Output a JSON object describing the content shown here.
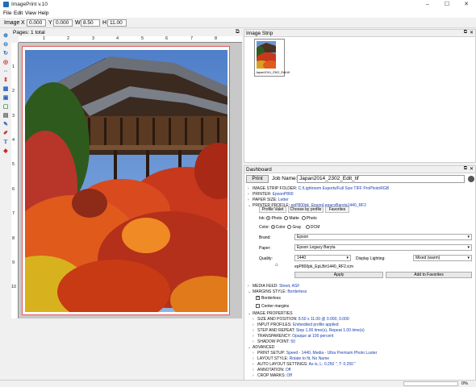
{
  "window": {
    "title": "ImagePrint v.10",
    "min": "–",
    "max": "☐",
    "close": "✕"
  },
  "menu": [
    "File",
    "Edit",
    "View",
    "Help"
  ],
  "toolbar": {
    "image_label": "Image",
    "x_label": "X",
    "x_value": "0.000",
    "y_label": "Y",
    "y_value": "0.000",
    "w_label": "W",
    "w_value": "8.50",
    "h_label": "H",
    "h_value": "11.00"
  },
  "pages": {
    "header": "Pages: 1 total"
  },
  "ruler": {
    "horizontal": [
      "1",
      "2",
      "3",
      "4",
      "5",
      "6",
      "7",
      "8"
    ],
    "vertical": [
      "1",
      "2",
      "3",
      "4",
      "5",
      "6",
      "7",
      "8",
      "9",
      "10"
    ]
  },
  "strip": {
    "header": "Image Strip",
    "thumb_label": "Japan2014_2302_Edit.tif"
  },
  "dashboard": {
    "header": "Dashboard",
    "print_label": "Print",
    "job_name_label": "Job Name:",
    "job_name_value": "Japan2014_2302_Edit_tif",
    "sections_top": [
      {
        "key": "IMAGE STRIP FOLDER:",
        "value": "C:/Lightroom Exports/Full Size TIFF ProPhotoRGB"
      },
      {
        "key": "PRINTER:",
        "value": "EpsonP800"
      },
      {
        "key": "PAPER SIZE:",
        "value": "Letter"
      },
      {
        "key": "PRINTER PROFILE:",
        "value": "epP800pk_EpsonLegacyBaryta1440_RF2"
      }
    ],
    "profile_tabs": [
      "Profile Valet",
      "Choose by profile",
      "Favorites"
    ],
    "ink": {
      "label": "Ink:",
      "options": [
        "Photo",
        "Matte",
        "Photo"
      ]
    },
    "color": {
      "label": "Color:",
      "options": [
        "Color",
        "Gray",
        "DCM"
      ]
    },
    "brand": {
      "label": "Brand:",
      "value": "Epson"
    },
    "paper": {
      "label": "Paper:",
      "value": "Epson Legacy Baryta"
    },
    "quality": {
      "label": "Quality:",
      "value": "1440"
    },
    "lighting": {
      "label": "Display Lighting:",
      "value": "Mixed (warm)"
    },
    "icc_file": "epP800pk_EpLBrt1440_RF2.icm",
    "apply_label": "Apply",
    "fav_label": "Add to Favorites",
    "media": [
      {
        "key": "MEDIA FEED:",
        "value": "Sheet, ASF"
      },
      {
        "key": "MARGINS STYLE:",
        "value": "Borderless"
      }
    ],
    "borderless_label": "Borderless",
    "center_label": "Center margins",
    "image_props_header": "IMAGE PROPERTIES",
    "image_props": [
      {
        "key": "SIZE AND POSITION:",
        "value": "8.50 x 11.00 @ 0.000, 0.000"
      },
      {
        "key": "INPUT PROFILES:",
        "value": "Embedded profile applied"
      },
      {
        "key": "STEP AND REPEAT:",
        "value": "Step 1.00 time(s), Repeat 1.00 time(s)"
      },
      {
        "key": "TRANSPARENCY:",
        "value": "Opaque at 100 percent"
      },
      {
        "key": "SHADOW POINT:",
        "value": "50"
      }
    ],
    "advanced_header": "ADVANCED",
    "advanced": [
      {
        "key": "PRINT SETUP:",
        "value": "Speed - 1440, Media - Ultra Premium Photo Luster"
      },
      {
        "key": "LAYOUT STYLE:",
        "value": "Rotate to fit, No Name"
      },
      {
        "key": "AUTO LAYOUT SETTINGS:",
        "value": "As is, L: 0.250 \", T: 0.250 \""
      },
      {
        "key": "ANNOTATION:",
        "value": "Off"
      },
      {
        "key": "CROP MARKS:",
        "value": "Off"
      }
    ]
  },
  "status": {
    "zoom": "0%"
  },
  "colors": {
    "accent": "#1a40b0",
    "paper_border": "#e05a5a"
  }
}
